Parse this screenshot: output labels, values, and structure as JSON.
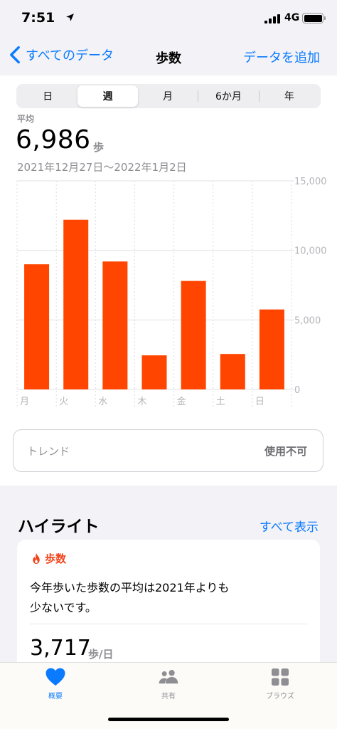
{
  "status": {
    "time": "7:51",
    "network": "4G"
  },
  "nav": {
    "back_label": "すべてのデータ",
    "title": "歩数",
    "add_label": "データを追加"
  },
  "segments": [
    {
      "label": "日",
      "selected": false
    },
    {
      "label": "週",
      "selected": true
    },
    {
      "label": "月",
      "selected": false
    },
    {
      "label": "6か月",
      "selected": false
    },
    {
      "label": "年",
      "selected": false
    }
  ],
  "summary": {
    "label": "平均",
    "value": "6,986",
    "unit": "歩",
    "range": "2021年12月27日〜2022年1月2日"
  },
  "chart_data": {
    "type": "bar",
    "categories": [
      "月",
      "火",
      "水",
      "木",
      "金",
      "土",
      "日"
    ],
    "values": [
      9000,
      12200,
      9200,
      2450,
      7800,
      2550,
      5750
    ],
    "ylim": [
      0,
      15000
    ],
    "yticks": [
      "15,000",
      "10,000",
      "5,000",
      "0"
    ],
    "bar_color": "#ff4500",
    "grid": true
  },
  "trend": {
    "label": "トレンド",
    "status": "使用不可"
  },
  "highlights": {
    "title": "ハイライト",
    "see_all": "すべて表示",
    "card": {
      "category": "歩数",
      "icon": "flame-icon",
      "text_line1": "今年歩いた歩数の平均は2021年よりも",
      "text_line2": "少ないです。",
      "value": "3,717",
      "unit": "歩/日"
    }
  },
  "tabs": [
    {
      "label": "概要",
      "icon": "heart-icon",
      "active": true
    },
    {
      "label": "共有",
      "icon": "people-icon",
      "active": false
    },
    {
      "label": "ブラウズ",
      "icon": "grid-icon",
      "active": false
    }
  ],
  "colors": {
    "accent": "#0a7aff",
    "steps": "#f2431a"
  }
}
